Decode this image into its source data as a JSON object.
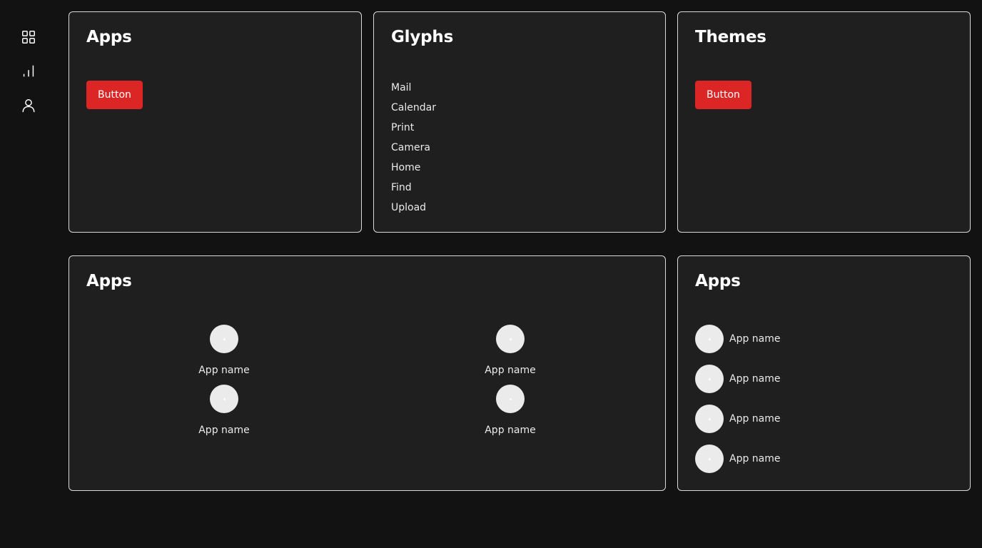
{
  "sidebar": {
    "items": [
      {
        "icon": "grid-icon"
      },
      {
        "icon": "bar-chart-icon"
      },
      {
        "icon": "user-icon"
      }
    ]
  },
  "apps_card": {
    "title": "Apps",
    "button_label": "Button"
  },
  "glyphs_card": {
    "title": "Glyphs",
    "items": [
      "Mail",
      "Calendar",
      "Print",
      "Camera",
      "Home",
      "Find",
      "Upload"
    ]
  },
  "themes_card": {
    "title": "Themes",
    "button_label": "Button"
  },
  "apps_grid_card": {
    "title": "Apps",
    "apps": [
      "App name",
      "App name",
      "App name",
      "App name"
    ]
  },
  "apps_list_card": {
    "title": "Apps",
    "apps": [
      "App name",
      "App name",
      "App name",
      "App name"
    ]
  },
  "colors": {
    "background": "#121212",
    "card": "#1f1f1f",
    "border": "#d9d9d9",
    "accent": "#dc2626",
    "app_icon": "#ebebeb"
  }
}
